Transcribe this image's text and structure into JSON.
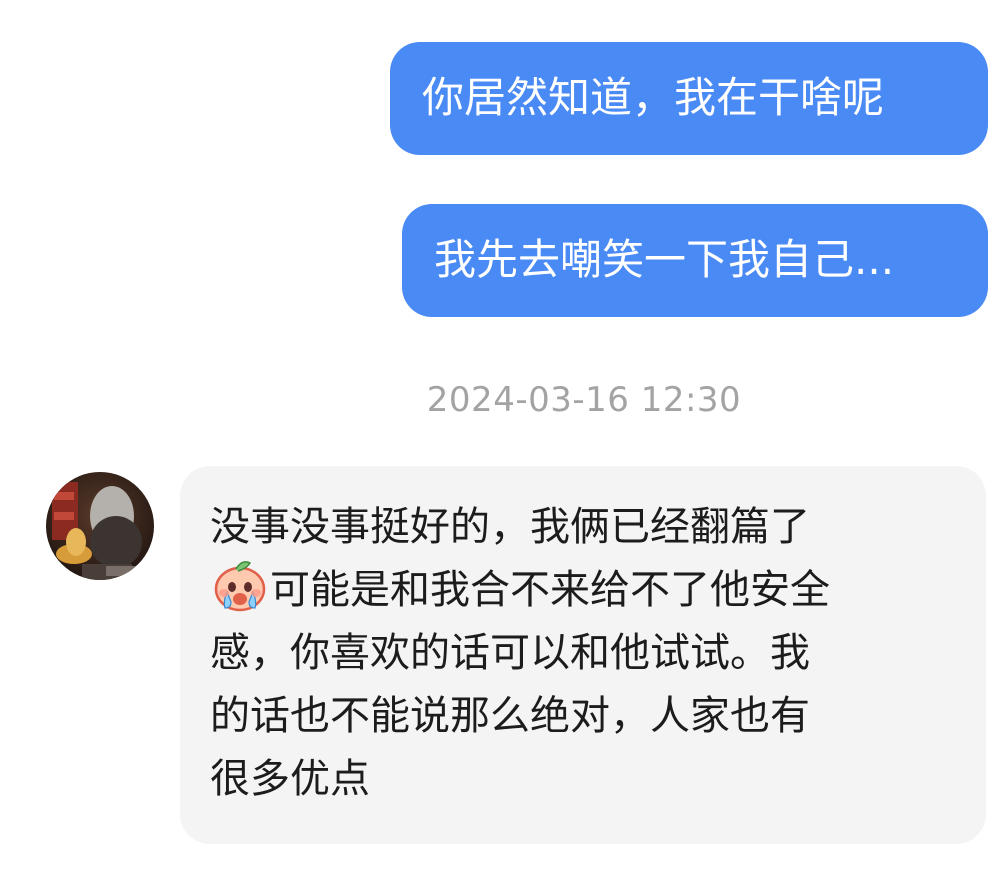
{
  "messages": {
    "outgoing": [
      {
        "text": "你居然知道，我在干啥呢"
      },
      {
        "text": "我先去嘲笑一下我自己..."
      }
    ],
    "timestamp": "2024-03-16 12:30",
    "incoming": {
      "lines": [
        "没事没事挺好的，我俩已经翻篇了",
        "可能是和我合不来给不了他安全",
        "感，你喜欢的话可以和他试试。我",
        "的话也不能说那么绝对，人家也有",
        "很多优点"
      ],
      "sticker_icon": "crying-peach-sticker-icon"
    }
  },
  "colors": {
    "outgoing_bubble": "#4a8af4",
    "incoming_bubble": "#f4f4f4",
    "timestamp_text": "#a3a3a3"
  }
}
